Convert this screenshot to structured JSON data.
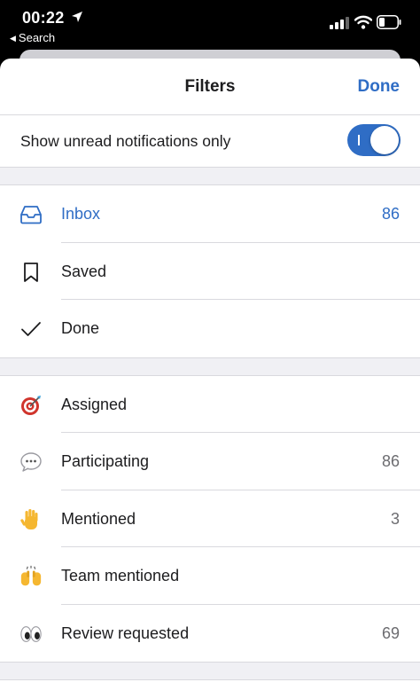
{
  "status_bar": {
    "time": "00:22",
    "back_label": "Search"
  },
  "nav": {
    "title": "Filters",
    "done_label": "Done"
  },
  "toggle": {
    "label": "Show unread notifications only",
    "on": true
  },
  "group1": [
    {
      "label": "Inbox",
      "count": "86",
      "icon": "inbox-icon"
    },
    {
      "label": "Saved",
      "count": "",
      "icon": "bookmark-icon"
    },
    {
      "label": "Done",
      "count": "",
      "icon": "checkmark-icon"
    }
  ],
  "group2": [
    {
      "label": "Assigned",
      "count": "",
      "icon": "target-icon"
    },
    {
      "label": "Participating",
      "count": "86",
      "icon": "speech-bubble-icon"
    },
    {
      "label": "Mentioned",
      "count": "3",
      "icon": "raised-hand-icon"
    },
    {
      "label": "Team mentioned",
      "count": "",
      "icon": "raised-hands-icon"
    },
    {
      "label": "Review requested",
      "count": "69",
      "icon": "eyes-icon"
    }
  ],
  "colors": {
    "accent": "#2f6dc5",
    "text": "#1c1c1e",
    "secondary": "#6c6c70"
  }
}
